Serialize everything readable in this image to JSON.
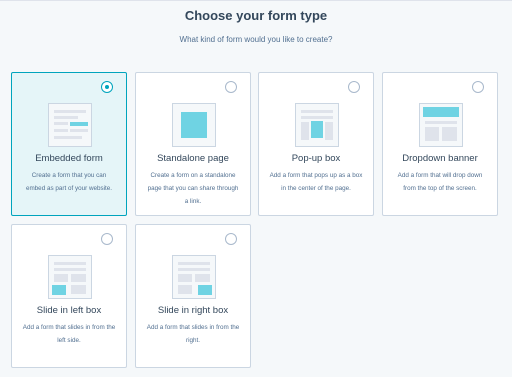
{
  "header": {
    "title": "Choose your form type",
    "subtitle": "What kind of form would you like to create?"
  },
  "cards": [
    {
      "title": "Embedded form",
      "description": "Create a form that you can embed as part of your website.",
      "selected": true
    },
    {
      "title": "Standalone page",
      "description": "Create a form on a standalone page that you can share through a link.",
      "selected": false
    },
    {
      "title": "Pop-up box",
      "description": "Add a form that pops up as a box in the center of the page.",
      "selected": false
    },
    {
      "title": "Dropdown banner",
      "description": "Add a form that will drop down from the top of the screen.",
      "selected": false
    },
    {
      "title": "Slide in left box",
      "description": "Add a form that slides in from the left side.",
      "selected": false
    },
    {
      "title": "Slide in right box",
      "description": "Add a form that slides in from the right.",
      "selected": false
    }
  ],
  "colors": {
    "accent": "#00a4bd",
    "accent_light": "#6fd3e3",
    "selected_bg": "#e5f5f8",
    "text": "#33475b"
  },
  "icons": [
    "embedded-form-icon",
    "standalone-page-icon",
    "popup-box-icon",
    "dropdown-banner-icon",
    "slide-in-left-icon",
    "slide-in-right-icon"
  ]
}
